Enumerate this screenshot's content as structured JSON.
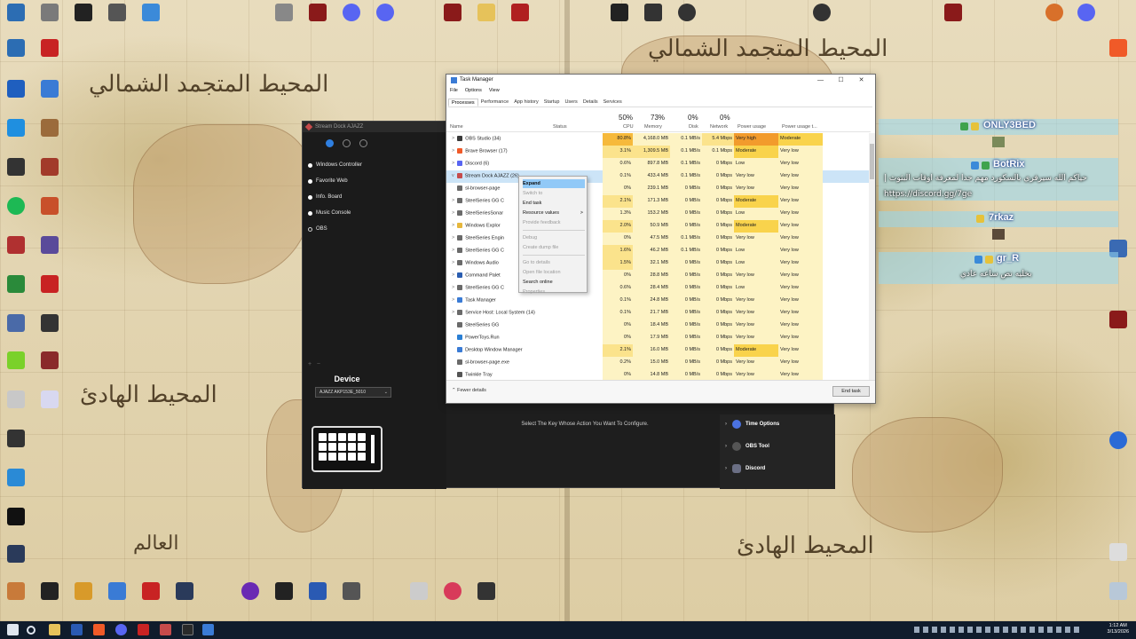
{
  "taskmanager": {
    "title": "Task Manager",
    "menu": [
      "File",
      "Options",
      "View"
    ],
    "tabs": [
      "Processes",
      "Performance",
      "App history",
      "Startup",
      "Users",
      "Details",
      "Services"
    ],
    "columns": {
      "name": "Name",
      "status": "Status",
      "cpu_pct": "50%",
      "cpu": "CPU",
      "mem_pct": "73%",
      "mem": "Memory",
      "disk_pct": "0%",
      "disk": "Disk",
      "net_pct": "0%",
      "net": "Network",
      "power": "Power usage",
      "power_trend": "Power usage t..."
    },
    "rows": [
      {
        "name": "OBS Studio (34)",
        "cpu": "80.8%",
        "mem": "4,168.0 MB",
        "disk": "0.1 MB/s",
        "net": "5.4 Mbps",
        "power": "Very high",
        "trend": "Moderate",
        "expand": ">",
        "icon_color": "#3a3a3a"
      },
      {
        "name": "Brave Browser (17)",
        "cpu": "3.1%",
        "mem": "1,309.5 MB",
        "disk": "0.1 MB/s",
        "net": "0.1 Mbps",
        "power": "Moderate",
        "trend": "Very low",
        "expand": ">",
        "icon_color": "#f05a28"
      },
      {
        "name": "Discord (6)",
        "cpu": "0.6%",
        "mem": "897.8 MB",
        "disk": "0.1 MB/s",
        "net": "0 Mbps",
        "power": "Low",
        "trend": "Very low",
        "expand": ">",
        "icon_color": "#5865f2"
      },
      {
        "name": "Stream Dock AJAZZ (26)",
        "cpu": "0.1%",
        "mem": "433.4 MB",
        "disk": "0.1 MB/s",
        "net": "0 Mbps",
        "power": "Very low",
        "trend": "Very low",
        "expand": "v",
        "icon_color": "#c64b4b"
      },
      {
        "name": "sl-browser-page",
        "cpu": "0%",
        "mem": "239.1 MB",
        "disk": "0 MB/s",
        "net": "0 Mbps",
        "power": "Very low",
        "trend": "Very low",
        "expand": "",
        "icon_color": "#6a6a6a"
      },
      {
        "name": "SteelSeries GG C",
        "cpu": "2.1%",
        "mem": "171.3 MB",
        "disk": "0 MB/s",
        "net": "0 Mbps",
        "power": "Moderate",
        "trend": "Very low",
        "expand": ">",
        "icon_color": "#6a6a6a"
      },
      {
        "name": "SteelSeriesSonar",
        "cpu": "1.3%",
        "mem": "153.2 MB",
        "disk": "0 MB/s",
        "net": "0 Mbps",
        "power": "Low",
        "trend": "Very low",
        "expand": ">",
        "icon_color": "#6a6a6a"
      },
      {
        "name": "Windows Explor",
        "cpu": "2.0%",
        "mem": "50.9 MB",
        "disk": "0 MB/s",
        "net": "0 Mbps",
        "power": "Moderate",
        "trend": "Very low",
        "expand": ">",
        "icon_color": "#e6b73c"
      },
      {
        "name": "SteelSeries Engin",
        "cpu": "0%",
        "mem": "47.5 MB",
        "disk": "0.1 MB/s",
        "net": "0 Mbps",
        "power": "Very low",
        "trend": "Very low",
        "expand": ">",
        "icon_color": "#6a6a6a"
      },
      {
        "name": "SteelSeries GG C",
        "cpu": "1.6%",
        "mem": "46.2 MB",
        "disk": "0.1 MB/s",
        "net": "0 Mbps",
        "power": "Low",
        "trend": "Very low",
        "expand": ">",
        "icon_color": "#6a6a6a"
      },
      {
        "name": "Windows Audio",
        "cpu": "1.5%",
        "mem": "32.1 MB",
        "disk": "0 MB/s",
        "net": "0 Mbps",
        "power": "Low",
        "trend": "Very low",
        "expand": ">",
        "icon_color": "#6a6a6a"
      },
      {
        "name": "Command Palet",
        "cpu": "0%",
        "mem": "28.8 MB",
        "disk": "0 MB/s",
        "net": "0 Mbps",
        "power": "Very low",
        "trend": "Very low",
        "expand": ">",
        "icon_color": "#2a5db0"
      },
      {
        "name": "SteelSeries GG C",
        "cpu": "0.6%",
        "mem": "28.4 MB",
        "disk": "0 MB/s",
        "net": "0 Mbps",
        "power": "Low",
        "trend": "Very low",
        "expand": ">",
        "icon_color": "#6a6a6a"
      },
      {
        "name": "Task Manager",
        "cpu": "0.1%",
        "mem": "24.8 MB",
        "disk": "0 MB/s",
        "net": "0 Mbps",
        "power": "Very low",
        "trend": "Very low",
        "expand": ">",
        "icon_color": "#3a7bd5"
      },
      {
        "name": "Service Host: Local System (14)",
        "cpu": "0.1%",
        "mem": "21.7 MB",
        "disk": "0 MB/s",
        "net": "0 Mbps",
        "power": "Very low",
        "trend": "Very low",
        "expand": ">",
        "icon_color": "#6a6a6a"
      },
      {
        "name": "SteelSeries GG",
        "cpu": "0%",
        "mem": "18.4 MB",
        "disk": "0 MB/s",
        "net": "0 Mbps",
        "power": "Very low",
        "trend": "Very low",
        "expand": "",
        "icon_color": "#6a6a6a"
      },
      {
        "name": "PowerToys.Run",
        "cpu": "0%",
        "mem": "17.9 MB",
        "disk": "0 MB/s",
        "net": "0 Mbps",
        "power": "Very low",
        "trend": "Very low",
        "expand": "",
        "icon_color": "#2a7fd4"
      },
      {
        "name": "Desktop Window Manager",
        "cpu": "2.1%",
        "mem": "16.0 MB",
        "disk": "0 MB/s",
        "net": "0 Mbps",
        "power": "Moderate",
        "trend": "Very low",
        "expand": "",
        "icon_color": "#3a7bd5"
      },
      {
        "name": "sl-browser-page.exe",
        "cpu": "0.2%",
        "mem": "15.0 MB",
        "disk": "0 MB/s",
        "net": "0 Mbps",
        "power": "Very low",
        "trend": "Very low",
        "expand": "",
        "icon_color": "#6a6a6a"
      },
      {
        "name": "Twinkle Tray",
        "cpu": "0%",
        "mem": "14.8 MB",
        "disk": "0 MB/s",
        "net": "0 Mbps",
        "power": "Very low",
        "trend": "Very low",
        "expand": "",
        "icon_color": "#555555"
      }
    ],
    "context_menu": [
      {
        "label": "Expand",
        "state": "highlight"
      },
      {
        "label": "Switch to",
        "state": "disabled"
      },
      {
        "label": "End task",
        "state": "normal"
      },
      {
        "label": "Resource values",
        "state": "normal",
        "submenu": ">"
      },
      {
        "label": "Provide feedback",
        "state": "disabled"
      },
      {
        "sep": true
      },
      {
        "label": "Debug",
        "state": "disabled"
      },
      {
        "label": "Create dump file",
        "state": "disabled"
      },
      {
        "sep": true
      },
      {
        "label": "Go to details",
        "state": "disabled"
      },
      {
        "label": "Open file location",
        "state": "disabled"
      },
      {
        "label": "Search online",
        "state": "normal"
      },
      {
        "label": "Properties",
        "state": "disabled"
      }
    ],
    "fewer_details": "Fewer details",
    "end_task": "End task",
    "colors": {
      "very_high": "#f29b2c",
      "moderate": "#f9d34c",
      "low_heat": "#fdf3c4",
      "mid_heat": "#fbe38c",
      "high_heat": "#f6b93b",
      "selection": "#cce4f7"
    }
  },
  "streamdock": {
    "title": "Stream Dock AJAZZ",
    "plugins": [
      {
        "label": "Windows Controller",
        "icon": "filled"
      },
      {
        "label": "Favorite Web",
        "icon": "filled"
      },
      {
        "label": "Info. Board",
        "icon": "filled"
      },
      {
        "label": "Music Console",
        "icon": "filled"
      },
      {
        "label": "OBS",
        "icon": "hollow"
      }
    ],
    "device_label": "Device",
    "device_value": "AJAZZ AKP153E_5010",
    "hint": "Select The Key Whose Action You Want To Configure.",
    "categories": [
      {
        "label": "Time Options",
        "icon": "clock-icon"
      },
      {
        "label": "OBS Tool",
        "icon": "obs-icon"
      },
      {
        "label": "Discord",
        "icon": "discord-icon"
      }
    ]
  },
  "chat": {
    "messages": [
      {
        "user": "ONLY3BED",
        "text": ""
      },
      {
        "user": "BotRix",
        "text": "| حياكم الله سيرفري بالسكورد مهم جدا لمعرفة اوقات البثوث",
        "text2": "https://discord.gg/7ge"
      },
      {
        "user": "7rkaz",
        "text": ""
      },
      {
        "user": "gr_R",
        "text": "بخليه نص ساعه عادي"
      }
    ],
    "colors": {
      "band": "#96d7f0",
      "name_glow": "#1a3a8a"
    }
  },
  "taskbar": {
    "time": "1:12 AM",
    "date": "3/13/2026"
  }
}
